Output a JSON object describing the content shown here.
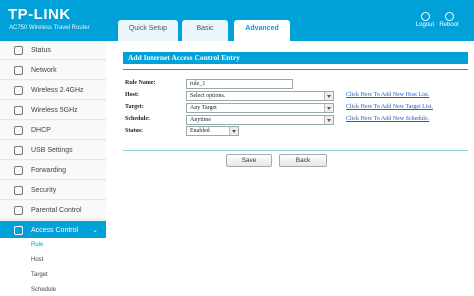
{
  "header": {
    "logo": "TP-LINK",
    "model": "AC750 Wireless Travel Router",
    "tabs": [
      "Quick Setup",
      "Basic",
      "Advanced"
    ],
    "logout": "Logout",
    "reboot": "Reboot",
    "accent_color": "#00a0d8"
  },
  "sidebar": {
    "items": [
      {
        "label": "Status",
        "icon": "status-icon"
      },
      {
        "label": "Network",
        "icon": "network-icon"
      },
      {
        "label": "Wireless 2.4GHz",
        "icon": "wireless-icon"
      },
      {
        "label": "Wireless 5GHz",
        "icon": "wireless-icon"
      },
      {
        "label": "DHCP",
        "icon": "dhcp-icon"
      },
      {
        "label": "USB Settings",
        "icon": "usb-icon"
      },
      {
        "label": "Forwarding",
        "icon": "forwarding-icon"
      },
      {
        "label": "Security",
        "icon": "security-icon"
      },
      {
        "label": "Parental Control",
        "icon": "parental-icon"
      },
      {
        "label": "Access Control",
        "icon": "access-icon"
      }
    ],
    "subitems": [
      "Rule",
      "Host",
      "Target",
      "Schedule"
    ],
    "active": "Access Control",
    "active_sub": "Rule"
  },
  "form": {
    "title": "Add Internet Access Control Entry",
    "rule_name_label": "Rule Name:",
    "rule_name_value": "rule_1",
    "host_label": "Host:",
    "host_value": "Select options.",
    "host_link": "Click Here To Add New Host List.",
    "target_label": "Target:",
    "target_value": "Any Target",
    "target_link": "Click Here To Add New Target List.",
    "schedule_label": "Schedule:",
    "schedule_value": "Anytime",
    "schedule_link": "Click Here To Add New Schedule.",
    "status_label": "Status:",
    "status_value": "Enabled",
    "save": "Save",
    "back": "Back"
  }
}
